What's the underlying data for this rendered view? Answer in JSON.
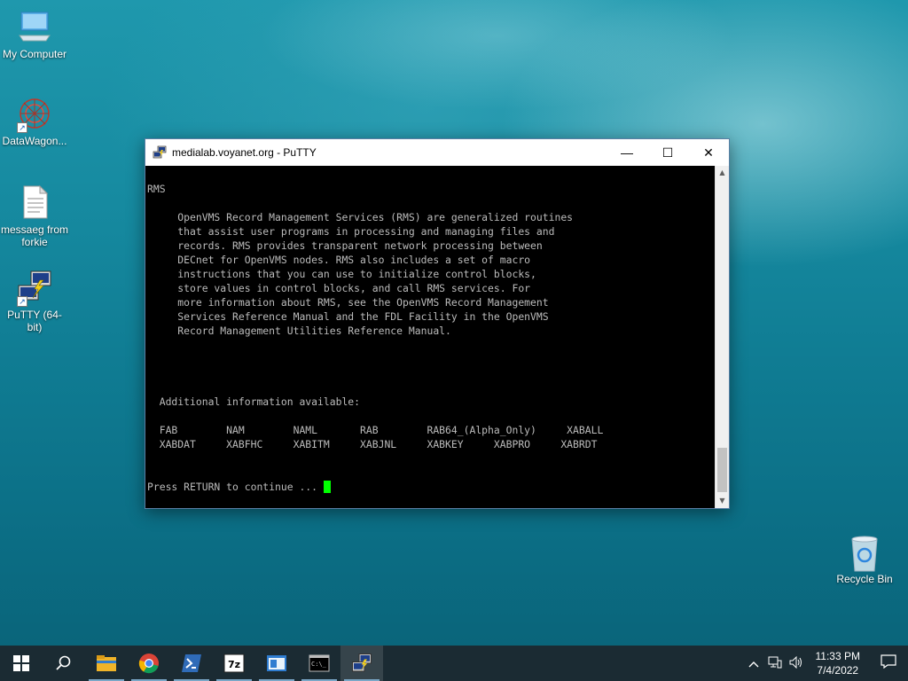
{
  "desktop": {
    "icons": [
      {
        "label": "My Computer"
      },
      {
        "label": "DataWagon..."
      },
      {
        "label": "messaeg from forkie"
      },
      {
        "label": "PuTTY (64-bit)"
      },
      {
        "label": "Recycle Bin"
      }
    ]
  },
  "window": {
    "title": "medialab.voyanet.org - PuTTY",
    "buttons": {
      "minimize": "—",
      "maximize": "☐",
      "close": "✕"
    }
  },
  "terminal": {
    "lines": [
      "RMS",
      "",
      "     OpenVMS Record Management Services (RMS) are generalized routines",
      "     that assist user programs in processing and managing files and",
      "     records. RMS provides transparent network processing between",
      "     DECnet for OpenVMS nodes. RMS also includes a set of macro",
      "     instructions that you can use to initialize control blocks,",
      "     store values in control blocks, and call RMS services. For",
      "     more information about RMS, see the OpenVMS Record Management",
      "     Services Reference Manual and the FDL Facility in the OpenVMS",
      "     Record Management Utilities Reference Manual.",
      "",
      "",
      "",
      "",
      "  Additional information available:",
      "",
      "  FAB        NAM        NAML       RAB        RAB64_(Alpha_Only)     XABALL",
      "  XABDAT     XABFHC     XABITM     XABJNL     XABKEY     XABPRO     XABRDT",
      "",
      "",
      "Press RETURN to continue ... "
    ]
  },
  "taskbar": {
    "items": [
      {
        "name": "start",
        "icon": "windows-icon"
      },
      {
        "name": "search",
        "icon": "search-icon"
      },
      {
        "name": "explorer",
        "icon": "folder-icon"
      },
      {
        "name": "chrome",
        "icon": "chrome-icon"
      },
      {
        "name": "powershell",
        "icon": "powershell-icon"
      },
      {
        "name": "7zip",
        "icon": "7zip-icon"
      },
      {
        "name": "app",
        "icon": "window-app-icon"
      },
      {
        "name": "cmd",
        "icon": "cmd-icon"
      },
      {
        "name": "putty",
        "icon": "putty-icon"
      }
    ],
    "clock": {
      "time": "11:33 PM",
      "date": "7/4/2022"
    }
  },
  "colors": {
    "cursor": "#00ff00",
    "terminal_bg": "#000000",
    "terminal_fg": "#bbbbbb"
  }
}
